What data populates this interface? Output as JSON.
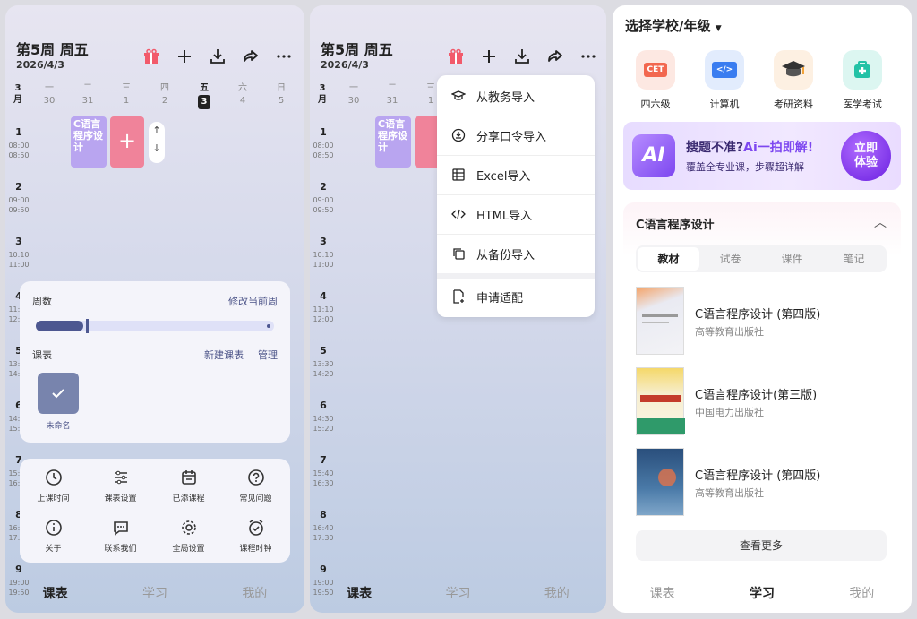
{
  "screen1": {
    "header": {
      "title": "第5周  周五",
      "date": "2026/4/3"
    },
    "month": {
      "num": "3",
      "label": "月"
    },
    "days": [
      {
        "name": "一",
        "date": "30"
      },
      {
        "name": "二",
        "date": "31"
      },
      {
        "name": "三",
        "date": "1"
      },
      {
        "name": "四",
        "date": "2"
      },
      {
        "name": "五",
        "date": "3"
      },
      {
        "name": "六",
        "date": "4"
      },
      {
        "name": "日",
        "date": "5"
      }
    ],
    "slots": [
      {
        "n": "1",
        "start": "08:00",
        "end": "08:50"
      },
      {
        "n": "2",
        "start": "09:00",
        "end": "09:50"
      },
      {
        "n": "3",
        "start": "10:10",
        "end": "11:00"
      },
      {
        "n": "4",
        "start": "11:10",
        "end": "12:00"
      },
      {
        "n": "5",
        "start": "13:30",
        "end": "14:20"
      },
      {
        "n": "6",
        "start": "14:30",
        "end": "15:20"
      },
      {
        "n": "7",
        "start": "15:40",
        "end": "16:30"
      },
      {
        "n": "8",
        "start": "16:40",
        "end": "17:30"
      },
      {
        "n": "9",
        "start": "19:00",
        "end": "19:50"
      }
    ],
    "course": "C语言程序设计",
    "add_symbol": "+",
    "week_panel": {
      "weeks_label": "周数",
      "edit_week": "修改当前周",
      "timetable_label": "课表",
      "new_timetable": "新建课表",
      "manage": "管理",
      "timetable_name": "未命名",
      "week_progress": 0.2
    },
    "grid_items": [
      "上课时间",
      "课表设置",
      "已添课程",
      "常见问题",
      "关于",
      "联系我们",
      "全局设置",
      "课程时钟"
    ]
  },
  "screen2": {
    "header": {
      "title": "第5周  周五",
      "date": "2026/4/3"
    },
    "menu": [
      "从教务导入",
      "分享口令导入",
      "Excel导入",
      "HTML导入",
      "从备份导入",
      "申请适配"
    ]
  },
  "tabs": [
    "课表",
    "学习",
    "我的"
  ],
  "screen3": {
    "school_select": "选择学校/年级",
    "categories": [
      {
        "label": "四六级",
        "badge": "CET",
        "color": "#fde8e2"
      },
      {
        "label": "计算机",
        "badge": "</>",
        "color": "#e2ecfd"
      },
      {
        "label": "考研资料",
        "badge": "",
        "color": "#fdf0e2"
      },
      {
        "label": "医学考试",
        "badge": "",
        "color": "#dcf6f1"
      }
    ],
    "banner": {
      "headline_1": "搜题不准?",
      "headline_2": "Ai一拍即解!",
      "sub": "覆盖全专业课，步骤超详解",
      "cta_1": "立即",
      "cta_2": "体验",
      "logo": "AI"
    },
    "section": {
      "title": "C语言程序设计",
      "tabs": [
        "教材",
        "试卷",
        "课件",
        "笔记"
      ],
      "books": [
        {
          "title": "C语言程序设计 (第四版)",
          "publisher": "高等教育出版社"
        },
        {
          "title": "C语言程序设计(第三版)",
          "publisher": "中国电力出版社"
        },
        {
          "title": "C语言程序设计 (第四版)",
          "publisher": "高等教育出版社"
        }
      ],
      "more": "查看更多"
    }
  }
}
